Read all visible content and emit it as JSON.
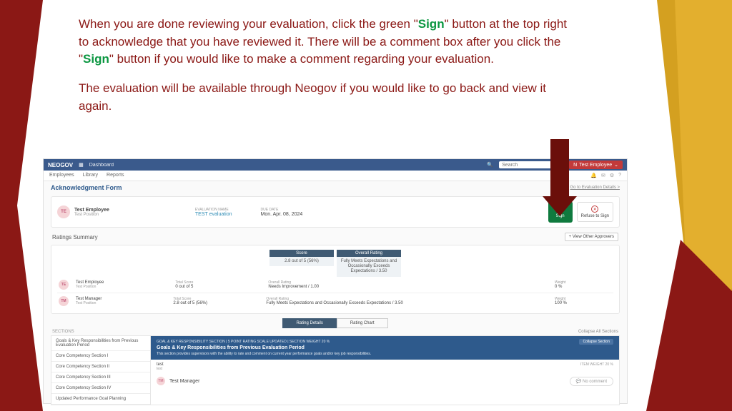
{
  "instruction": {
    "p1a": "When you are done reviewing your evaluation, click the green \"",
    "sign": "Sign",
    "p1b": "\" button at the top right to acknowledge that you have reviewed it. There will be a comment box after you click the \"",
    "p1c": "\" button if you would like to make a comment regarding your evaluation.",
    "p2": "The evaluation will be available through Neogov if you would like to go back and view it again."
  },
  "topbar": {
    "brand": "NEOGOV",
    "dashboard": "Dashboard",
    "search_placeholder": "Search",
    "user_initials": "N",
    "user_name": "Test Employee"
  },
  "subnav": {
    "items": [
      "Employees",
      "Library",
      "Reports"
    ]
  },
  "page": {
    "title": "Acknowledgment Form",
    "details_link": "Go to Evaluation Details >"
  },
  "header_card": {
    "avatar": "TE",
    "name": "Test Employee",
    "position": "Test Position",
    "eval_label": "EVALUATION NAME",
    "eval_value": "TEST evaluation",
    "due_label": "DUE DATE",
    "due_value": "Mon. Apr. 08, 2024",
    "sign_btn": "Sign",
    "refuse_btn": "Refuse to Sign"
  },
  "summary": {
    "title": "Ratings Summary",
    "other_approvers": "+ View Other Approvers",
    "score_hdr": "Score",
    "score_val": "2.8 out of 5 (56%)",
    "overall_hdr": "Overall Rating",
    "overall_val": "Fully Meets Expectations and Occasionally Exceeds Expectations / 3.50",
    "rows": [
      {
        "avatar": "TE",
        "name": "Test Employee",
        "position": "Test Position",
        "score_lbl": "Total Score",
        "score": "0 out of 5",
        "rating_lbl": "Overall Rating",
        "rating": "Needs Improvement / 1.00",
        "weight_lbl": "Weight",
        "weight": "0 %"
      },
      {
        "avatar": "TM",
        "name": "Test Manager",
        "position": "Test Position",
        "score_lbl": "Total Score",
        "score": "2.8 out of 5 (56%)",
        "rating_lbl": "Overall Rating",
        "rating": "Fully Meets Expectations and Occasionally Exceeds Expectations / 3.50",
        "weight_lbl": "Weight",
        "weight": "100 %"
      }
    ]
  },
  "tabs": {
    "active": "Rating Details",
    "inactive": "Rating Chart"
  },
  "sections": {
    "label": "SECTIONS",
    "collapse_all": "Collapse All Sections",
    "nav": [
      "Goals & Key Responsibilities from Previous Evaluation Period",
      "Core Competency Section I",
      "Core Competency Section II",
      "Core Competency Section III",
      "Core Competency Section IV",
      "Updated Performance Goal Planning"
    ],
    "banner_meta": "GOAL & KEY RESPONSIBILITY SECTION | 5 POINT RATING SCALE UPDATED | SECTION WEIGHT 20 %",
    "banner_title": "Goals & Key Responsibilities from Previous Evaluation Period",
    "banner_desc": "This section provides supervisors with the ability to rate and comment on current year performance goals and/or key job responsibilities.",
    "banner_collapse": "Collapse Section",
    "item_name": "test",
    "item_sub": "test",
    "item_weight": "ITEM WEIGHT 20 %",
    "manager_avatar": "TM",
    "manager_name": "Test Manager",
    "no_comment": "No comment"
  }
}
